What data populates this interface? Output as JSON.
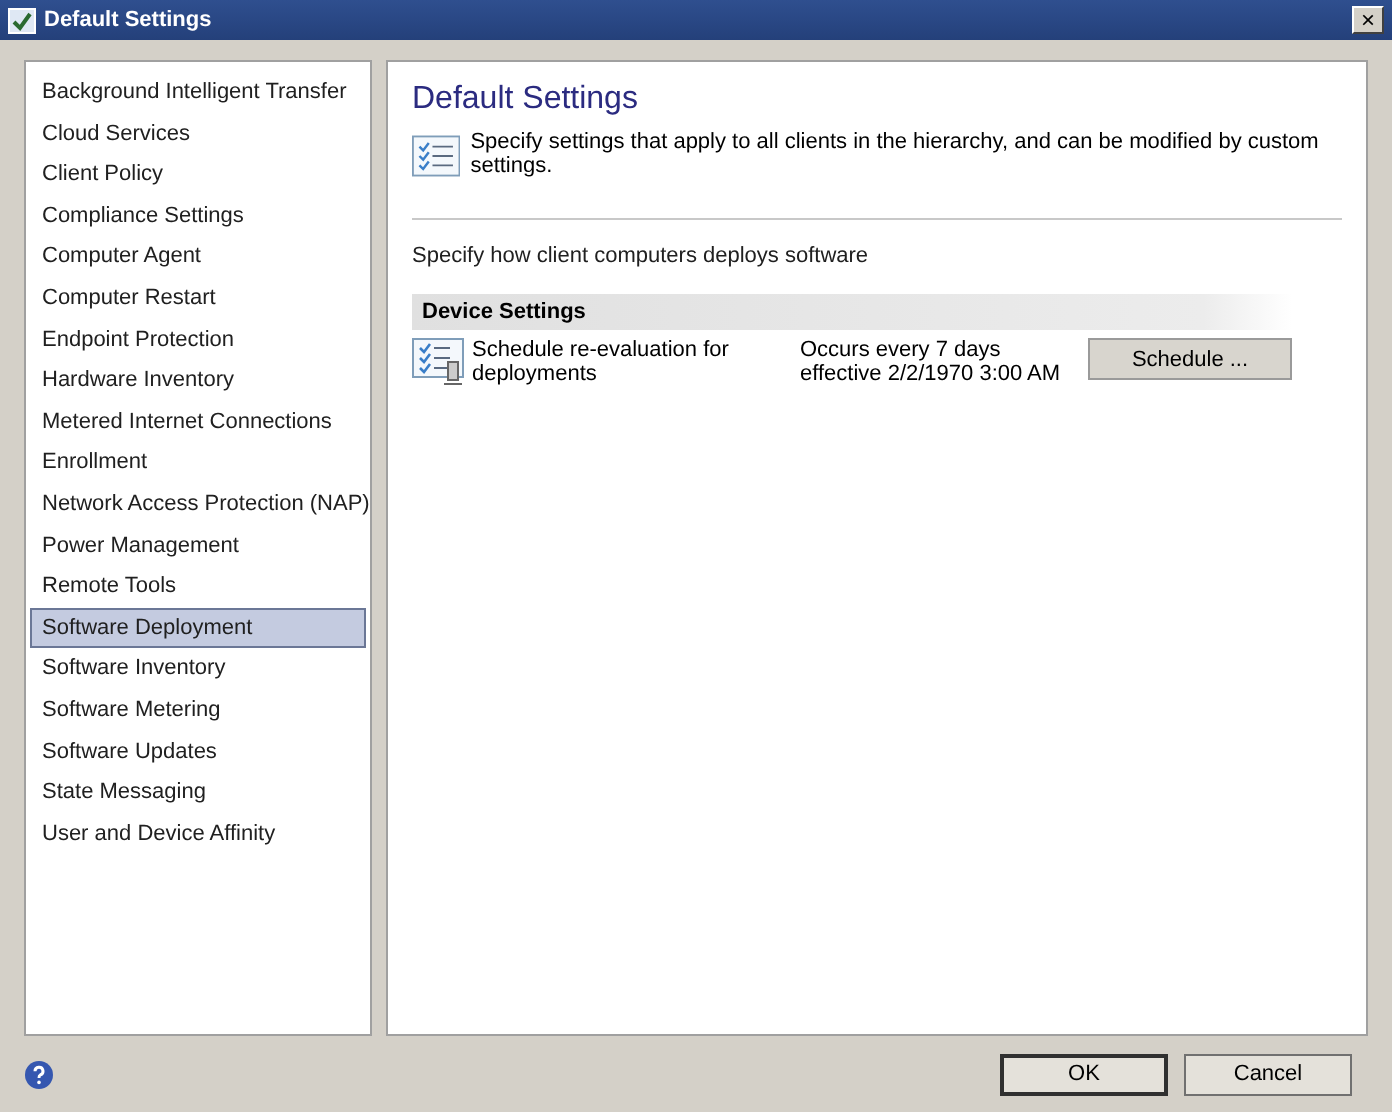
{
  "window": {
    "title": "Default Settings",
    "close": "×"
  },
  "sidebar": {
    "items": [
      {
        "label": "Background Intelligent Transfer",
        "selected": false
      },
      {
        "label": "Cloud Services",
        "selected": false
      },
      {
        "label": "Client Policy",
        "selected": false
      },
      {
        "label": "Compliance Settings",
        "selected": false
      },
      {
        "label": "Computer Agent",
        "selected": false
      },
      {
        "label": "Computer Restart",
        "selected": false
      },
      {
        "label": "Endpoint Protection",
        "selected": false
      },
      {
        "label": "Hardware Inventory",
        "selected": false
      },
      {
        "label": "Metered Internet Connections",
        "selected": false
      },
      {
        "label": "Enrollment",
        "selected": false
      },
      {
        "label": "Network Access Protection (NAP)",
        "selected": false
      },
      {
        "label": "Power Management",
        "selected": false
      },
      {
        "label": "Remote Tools",
        "selected": false
      },
      {
        "label": "Software Deployment",
        "selected": true
      },
      {
        "label": "Software Inventory",
        "selected": false
      },
      {
        "label": "Software Metering",
        "selected": false
      },
      {
        "label": "Software Updates",
        "selected": false
      },
      {
        "label": "State Messaging",
        "selected": false
      },
      {
        "label": "User and Device Affinity",
        "selected": false
      }
    ]
  },
  "main": {
    "heading": "Default Settings",
    "description": "Specify settings that apply to all clients in the hierarchy, and can be modified by custom settings.",
    "section_intro": "Specify how client computers deploys software",
    "group": {
      "title": "Device Settings",
      "settings": [
        {
          "label": "Schedule re-evaluation for deployments",
          "value": "Occurs every 7 days effective 2/2/1970 3:00 AM",
          "button": "Schedule ..."
        }
      ]
    }
  },
  "buttons": [
    "OK",
    "Cancel"
  ]
}
